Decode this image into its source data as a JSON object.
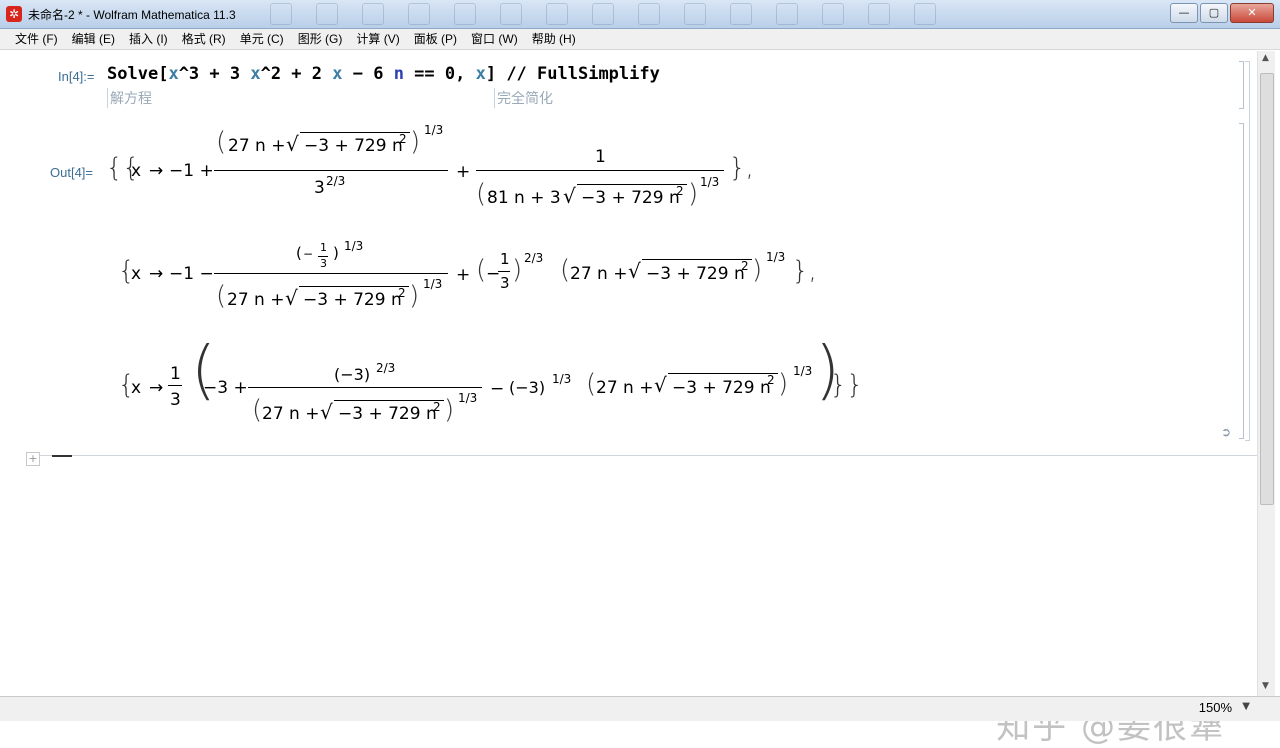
{
  "window": {
    "title": "未命名-2 * - Wolfram Mathematica 11.3",
    "buttons": {
      "minimize": "—",
      "maximize": "▢",
      "close": "✕"
    }
  },
  "menu": [
    "文件 (F)",
    "编辑 (E)",
    "插入 (I)",
    "格式 (R)",
    "单元 (C)",
    "图形 (G)",
    "计算 (V)",
    "面板 (P)",
    "窗口 (W)",
    "帮助 (H)"
  ],
  "input_cell": {
    "label": "In[4]:=",
    "tokens": [
      "Solve",
      "[",
      "x",
      "^3 + 3 ",
      "x",
      "^2 + 2 ",
      "x",
      " − 6 ",
      "n",
      " == 0, ",
      "x",
      "] // ",
      "FullSimplify"
    ],
    "hints": [
      "解方程",
      "完全简化"
    ]
  },
  "output_cell": {
    "label": "Out[4]=",
    "sol1": {
      "open": "{{",
      "x": "x",
      "arrow": "→",
      "minus1": "−1 +",
      "num_a": "27 n +",
      "rad_a": "−3 + 729 n",
      "pow2": "2",
      "exp13": "1/3",
      "den_a": "3",
      "exp23": "2/3",
      "plus": "+",
      "num_b": "1",
      "den_b": "81 n + 3",
      "rad_b": "−3 + 729 n",
      "close": "},"
    },
    "sol2": {
      "open": "{",
      "x": "x",
      "arrow": "→",
      "minus1": "−1 −",
      "neg": "−",
      "one": "1",
      "three": "3",
      "exp13": "1/3",
      "den_a": "27 n +",
      "rad_a": "−3 + 729 n",
      "pow2": "2",
      "plus": "+",
      "neg2": "−",
      "exp23": "2/3",
      "term_a": "27 n +",
      "rad_b": "−3 + 729 n",
      "close": "},"
    },
    "sol3": {
      "open": "{",
      "x": "x",
      "arrow": "→",
      "one": "1",
      "three": "3",
      "m3": "−3 +",
      "neg3": "(−3)",
      "exp23": "2/3",
      "den_a": "27 n +",
      "rad_a": "−3 + 729 n",
      "pow2": "2",
      "exp13": "1/3",
      "minus": "−",
      "neg3b": "(−3)",
      "term_b": "27 n +",
      "rad_b": "−3 + 729 n",
      "close": "}}"
    }
  },
  "status": {
    "zoom": "150%"
  },
  "watermark": "知乎 @姜很犟"
}
